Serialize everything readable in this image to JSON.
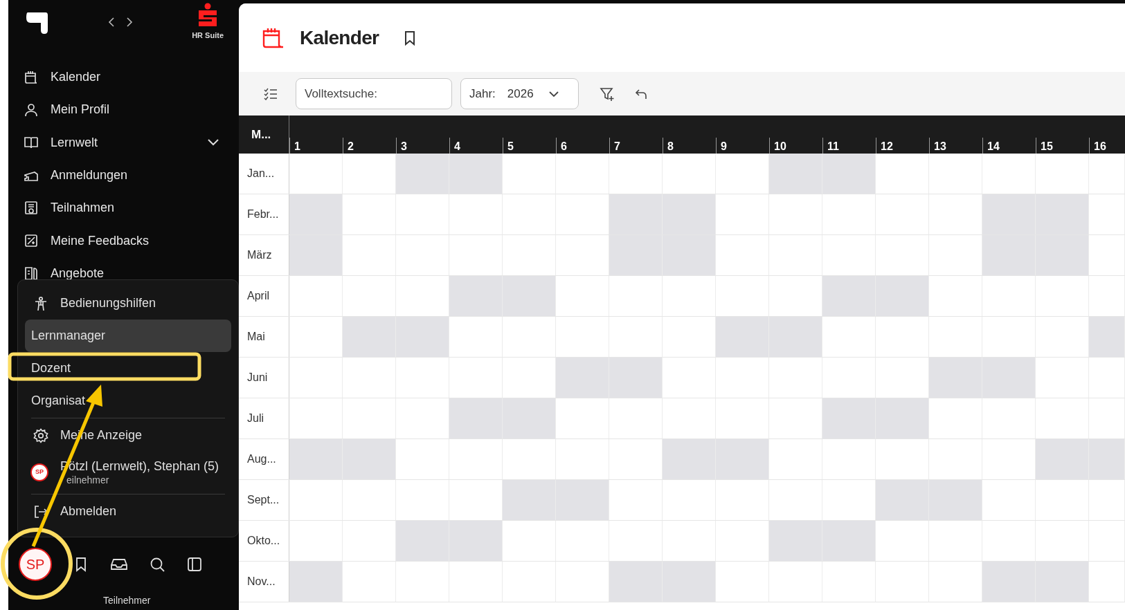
{
  "brand": {
    "suite": "HR Suite"
  },
  "nav": [
    {
      "label": "Kalender",
      "kind": "link"
    },
    {
      "label": "Mein Profil",
      "kind": "link"
    },
    {
      "label": "Lernwelt",
      "kind": "group"
    },
    {
      "label": "Anmeldungen",
      "kind": "link"
    },
    {
      "label": "Teilnahmen",
      "kind": "link"
    },
    {
      "label": "Meine Feedbacks",
      "kind": "link"
    },
    {
      "label": "Angebote",
      "kind": "link"
    }
  ],
  "account_menu": [
    {
      "kind": "action",
      "label": "Bedienungshilfen"
    },
    {
      "kind": "role",
      "label": "Lernmanager",
      "selected": true
    },
    {
      "kind": "role",
      "label": "Dozent",
      "selected": false
    },
    {
      "kind": "role",
      "label": "Organisat",
      "selected": false
    },
    {
      "kind": "divider"
    },
    {
      "kind": "action",
      "label": "Meine Anzeige"
    },
    {
      "kind": "user",
      "initials": "SP",
      "label": "Pötzl (Lernwelt), Stephan (5)",
      "sublabel": "eilnehmer"
    },
    {
      "kind": "divider"
    },
    {
      "kind": "action",
      "label": "Abmelden"
    }
  ],
  "bottom_bar": {
    "initials": "SP",
    "role": "Teilnehmer"
  },
  "page": {
    "title": "Kalender"
  },
  "toolbar": {
    "search": {
      "placeholder": "Volltextsuche:"
    },
    "year": {
      "label": "Jahr:",
      "value": "2026"
    }
  },
  "calendar": {
    "corner": "M...",
    "days": [
      "1",
      "2",
      "3",
      "4",
      "5",
      "6",
      "7",
      "8",
      "9",
      "10",
      "11",
      "12",
      "13",
      "14",
      "15",
      "16"
    ],
    "months": [
      {
        "label": "Jan...",
        "shaded": [
          false,
          false,
          true,
          true,
          false,
          false,
          false,
          false,
          false,
          true,
          true,
          false,
          false,
          false,
          false,
          false
        ]
      },
      {
        "label": "Febr...",
        "shaded": [
          true,
          false,
          false,
          false,
          false,
          false,
          true,
          true,
          false,
          false,
          false,
          false,
          false,
          true,
          true,
          false
        ]
      },
      {
        "label": "März",
        "shaded": [
          true,
          false,
          false,
          false,
          false,
          false,
          true,
          true,
          false,
          false,
          false,
          false,
          false,
          true,
          true,
          false
        ]
      },
      {
        "label": "April",
        "shaded": [
          false,
          false,
          false,
          true,
          true,
          false,
          false,
          false,
          false,
          false,
          true,
          true,
          false,
          false,
          false,
          false
        ]
      },
      {
        "label": "Mai",
        "shaded": [
          false,
          true,
          true,
          false,
          false,
          false,
          false,
          false,
          true,
          true,
          false,
          false,
          false,
          false,
          false,
          true
        ]
      },
      {
        "label": "Juni",
        "shaded": [
          false,
          false,
          false,
          false,
          false,
          true,
          true,
          false,
          false,
          false,
          false,
          false,
          true,
          true,
          false,
          false
        ]
      },
      {
        "label": "Juli",
        "shaded": [
          false,
          false,
          false,
          true,
          true,
          false,
          false,
          false,
          false,
          false,
          true,
          true,
          false,
          false,
          false,
          false
        ]
      },
      {
        "label": "Aug...",
        "shaded": [
          true,
          true,
          false,
          false,
          false,
          false,
          false,
          true,
          true,
          false,
          false,
          false,
          false,
          false,
          true,
          true
        ]
      },
      {
        "label": "Sept...",
        "shaded": [
          false,
          false,
          false,
          false,
          true,
          true,
          false,
          false,
          false,
          false,
          false,
          true,
          true,
          false,
          false,
          false
        ]
      },
      {
        "label": "Okto...",
        "shaded": [
          false,
          false,
          true,
          true,
          false,
          false,
          false,
          false,
          false,
          true,
          true,
          false,
          false,
          false,
          false,
          false
        ]
      },
      {
        "label": "Nov...",
        "shaded": [
          true,
          false,
          false,
          false,
          false,
          false,
          true,
          true,
          false,
          false,
          false,
          false,
          false,
          true,
          true,
          false
        ]
      }
    ]
  }
}
